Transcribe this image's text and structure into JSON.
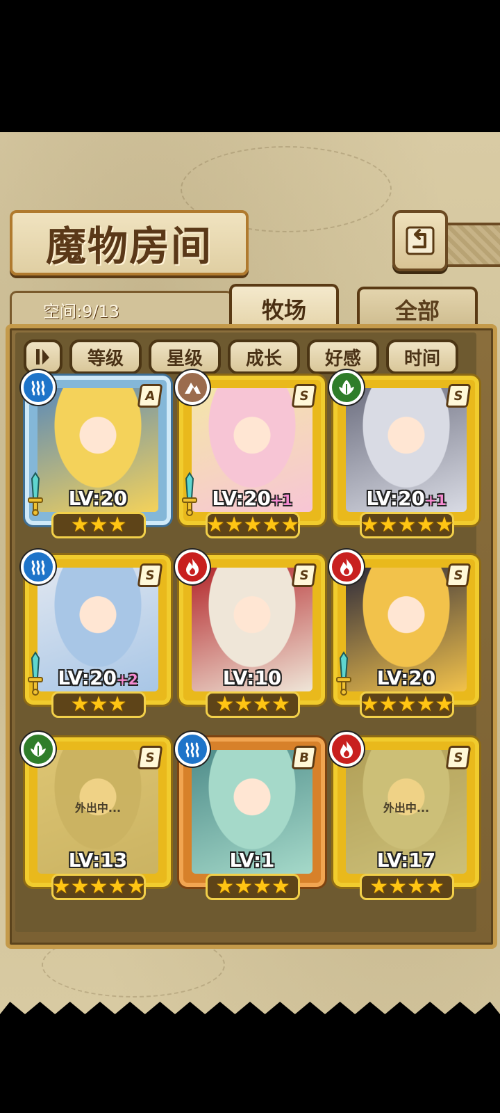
{
  "header": {
    "title": "魔物房间",
    "space_label": "空间:9/13"
  },
  "tabs": [
    {
      "label": "牧场",
      "active": true
    },
    {
      "label": "全部",
      "active": false
    }
  ],
  "filters": [
    "等级",
    "星级",
    "成长",
    "好感",
    "时间"
  ],
  "monsters": [
    {
      "element": "water-icon",
      "rank": "A",
      "level": "LV:20",
      "bonus": "",
      "stars": 3,
      "frame": "blue",
      "weapon": true,
      "away": ""
    },
    {
      "element": "earth-icon",
      "rank": "S",
      "level": "LV:20",
      "bonus": "+1",
      "stars": 5,
      "frame": "gold",
      "weapon": true,
      "away": ""
    },
    {
      "element": "nature-icon",
      "rank": "S",
      "level": "LV:20",
      "bonus": "+1",
      "stars": 5,
      "frame": "gold",
      "weapon": false,
      "away": ""
    },
    {
      "element": "water-icon",
      "rank": "S",
      "level": "LV:20",
      "bonus": "+2",
      "stars": 3,
      "frame": "gold",
      "weapon": true,
      "away": ""
    },
    {
      "element": "fire-icon",
      "rank": "S",
      "level": "LV:10",
      "bonus": "",
      "stars": 4,
      "frame": "gold",
      "weapon": false,
      "away": ""
    },
    {
      "element": "fire-icon",
      "rank": "S",
      "level": "LV:20",
      "bonus": "",
      "stars": 5,
      "frame": "gold",
      "weapon": true,
      "away": ""
    },
    {
      "element": "nature-icon",
      "rank": "S",
      "level": "LV:13",
      "bonus": "",
      "stars": 5,
      "frame": "gold",
      "weapon": false,
      "away": "外出中..."
    },
    {
      "element": "water-icon",
      "rank": "B",
      "level": "LV:1",
      "bonus": "",
      "stars": 4,
      "frame": "orange",
      "weapon": false,
      "away": ""
    },
    {
      "element": "fire-icon",
      "rank": "S",
      "level": "LV:17",
      "bonus": "",
      "stars": 4,
      "frame": "gold",
      "weapon": false,
      "away": "外出中..."
    }
  ],
  "colors": {
    "gold": "#f1cc2e",
    "parchment": "#d9cba4",
    "panel": "#7b6133",
    "star": "#ffc514",
    "bonus": "#f58ad0"
  }
}
